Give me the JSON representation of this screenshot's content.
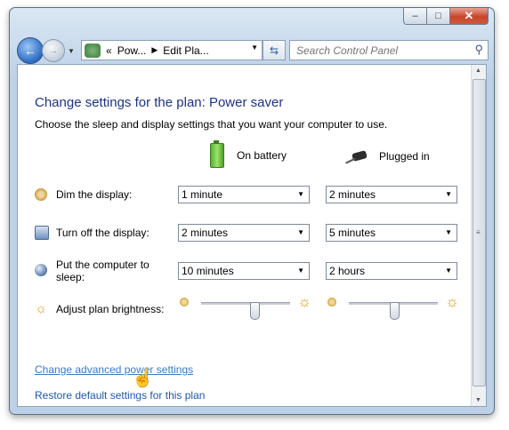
{
  "window": {
    "minimize_glyph": "–",
    "maximize_glyph": "□",
    "close_glyph": "✕"
  },
  "nav": {
    "back_glyph": "←",
    "forward_glyph": "→"
  },
  "address": {
    "chevrons": "«",
    "segments": [
      "Pow...",
      "Edit Pla..."
    ],
    "sep_glyph": "▶"
  },
  "search": {
    "placeholder": "Search Control Panel"
  },
  "main": {
    "title": "Change settings for the plan: Power saver",
    "subtitle": "Choose the sleep and display settings that you want your computer to use.",
    "columns": {
      "battery_label": "On battery",
      "plugged_label": "Plugged in"
    },
    "rows": [
      {
        "label": "Dim the display:",
        "battery": "1 minute",
        "plugged": "2 minutes"
      },
      {
        "label": "Turn off the display:",
        "battery": "2 minutes",
        "plugged": "5 minutes"
      },
      {
        "label_line1": "Put the computer to",
        "label_line2": "sleep:",
        "battery": "10 minutes",
        "plugged": "2 hours"
      },
      {
        "label": "Adjust plan brightness:"
      }
    ],
    "brightness": {
      "battery_level": 0.62,
      "plugged_level": 0.52
    },
    "links": {
      "advanced": "Change advanced power settings",
      "restore": "Restore default settings for this plan"
    }
  },
  "icons": {
    "dropdown_arrow": "▼",
    "sun": "☼"
  }
}
